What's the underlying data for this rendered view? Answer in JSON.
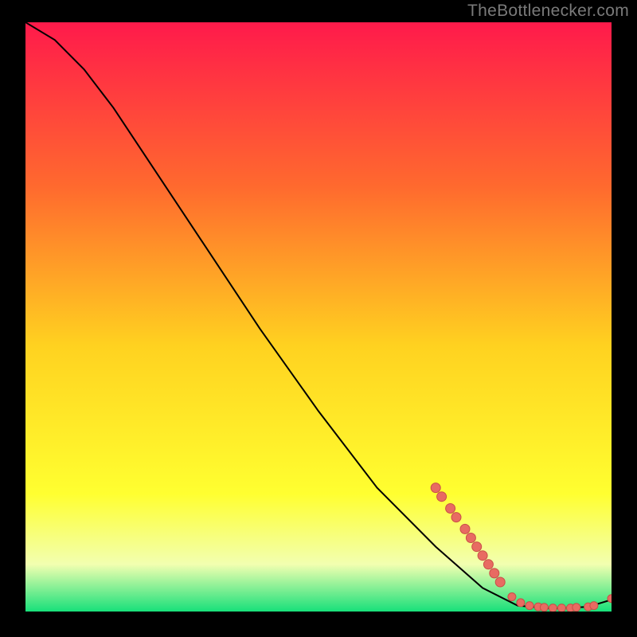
{
  "watermark": "TheBottlenecker.com",
  "colors": {
    "background_black": "#000000",
    "grad_top": "#ff1a4b",
    "grad_upper": "#ff6a2e",
    "grad_mid": "#ffd220",
    "grad_low": "#ffff30",
    "grad_light": "#f2ffb0",
    "grad_green": "#18e07a",
    "curve": "#000000",
    "marker_fill": "#e86b62",
    "marker_stroke": "#c94f47"
  },
  "chart_data": {
    "type": "line",
    "title": "",
    "xlabel": "",
    "ylabel": "",
    "xlim": [
      0,
      100
    ],
    "ylim": [
      0,
      100
    ],
    "curve": [
      {
        "x": 0,
        "y": 100
      },
      {
        "x": 5,
        "y": 97
      },
      {
        "x": 10,
        "y": 92
      },
      {
        "x": 15,
        "y": 85.5
      },
      {
        "x": 20,
        "y": 78
      },
      {
        "x": 30,
        "y": 63
      },
      {
        "x": 40,
        "y": 48
      },
      {
        "x": 50,
        "y": 34
      },
      {
        "x": 60,
        "y": 21
      },
      {
        "x": 70,
        "y": 11
      },
      {
        "x": 78,
        "y": 4
      },
      {
        "x": 84,
        "y": 1
      },
      {
        "x": 90,
        "y": 0.5
      },
      {
        "x": 96,
        "y": 0.8
      },
      {
        "x": 100,
        "y": 2
      }
    ],
    "markers": [
      {
        "x": 70,
        "y": 21,
        "r": 6
      },
      {
        "x": 71,
        "y": 19.5,
        "r": 6
      },
      {
        "x": 72.5,
        "y": 17.5,
        "r": 6
      },
      {
        "x": 73.5,
        "y": 16,
        "r": 6
      },
      {
        "x": 75,
        "y": 14,
        "r": 6
      },
      {
        "x": 76,
        "y": 12.5,
        "r": 6
      },
      {
        "x": 77,
        "y": 11,
        "r": 6
      },
      {
        "x": 78,
        "y": 9.5,
        "r": 6
      },
      {
        "x": 79,
        "y": 8,
        "r": 6
      },
      {
        "x": 80,
        "y": 6.5,
        "r": 6
      },
      {
        "x": 81,
        "y": 5,
        "r": 6
      },
      {
        "x": 83,
        "y": 2.5,
        "r": 5
      },
      {
        "x": 84.5,
        "y": 1.5,
        "r": 5
      },
      {
        "x": 86,
        "y": 1,
        "r": 5
      },
      {
        "x": 87.5,
        "y": 0.8,
        "r": 5
      },
      {
        "x": 88.5,
        "y": 0.7,
        "r": 5
      },
      {
        "x": 90,
        "y": 0.6,
        "r": 5
      },
      {
        "x": 91.5,
        "y": 0.6,
        "r": 5
      },
      {
        "x": 93,
        "y": 0.6,
        "r": 5
      },
      {
        "x": 94,
        "y": 0.7,
        "r": 5
      },
      {
        "x": 96,
        "y": 0.8,
        "r": 5
      },
      {
        "x": 97,
        "y": 1,
        "r": 5
      },
      {
        "x": 100,
        "y": 2.2,
        "r": 5
      }
    ]
  }
}
